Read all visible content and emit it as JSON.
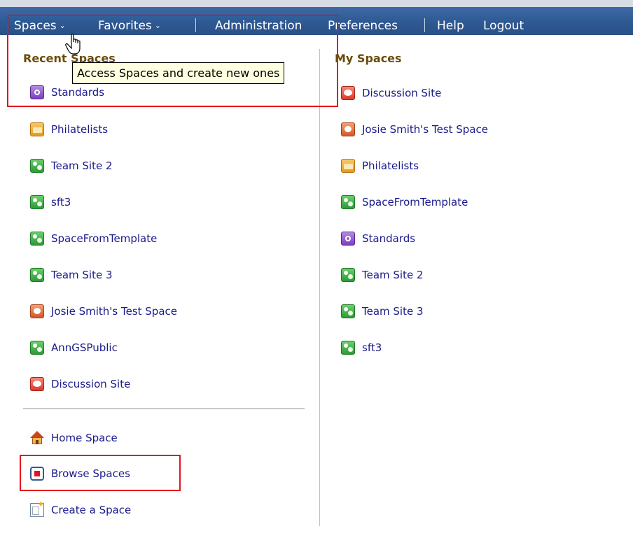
{
  "menu": {
    "spaces_label": "Spaces",
    "favorites_label": "Favorites",
    "administration_label": "Administration",
    "preferences_label": "Preferences",
    "help_label": "Help",
    "logout_label": "Logout",
    "chevron": "⌄"
  },
  "tooltip": "Access Spaces and create new ones",
  "recent": {
    "title": "Recent Spaces",
    "items": [
      {
        "label": "Standards",
        "icon": "purple-space-icon"
      },
      {
        "label": "Philatelists",
        "icon": "orange-folder-space-icon"
      },
      {
        "label": "Team Site 2",
        "icon": "green-team-space-icon"
      },
      {
        "label": "sft3",
        "icon": "green-team-space-icon"
      },
      {
        "label": "SpaceFromTemplate",
        "icon": "green-team-space-icon"
      },
      {
        "label": "Team Site 3",
        "icon": "green-team-space-icon"
      },
      {
        "label": "Josie Smith's Test Space",
        "icon": "orange-person-space-icon"
      },
      {
        "label": "AnnGSPublic",
        "icon": "green-team-space-icon"
      },
      {
        "label": "Discussion Site",
        "icon": "red-discussion-space-icon"
      }
    ]
  },
  "actions": {
    "home_space": "Home Space",
    "browse_spaces": "Browse Spaces",
    "create_space": "Create a Space"
  },
  "myspaces": {
    "title": "My Spaces",
    "items": [
      {
        "label": "Discussion Site",
        "icon": "red-discussion-space-icon"
      },
      {
        "label": "Josie Smith's Test Space",
        "icon": "orange-person-space-icon"
      },
      {
        "label": "Philatelists",
        "icon": "orange-folder-space-icon"
      },
      {
        "label": "SpaceFromTemplate",
        "icon": "green-team-space-icon"
      },
      {
        "label": "Standards",
        "icon": "purple-space-icon"
      },
      {
        "label": "Team Site 2",
        "icon": "green-team-space-icon"
      },
      {
        "label": "Team Site 3",
        "icon": "green-team-space-icon"
      },
      {
        "label": "sft3",
        "icon": "green-team-space-icon"
      }
    ]
  },
  "colors": {
    "menubar": "#2f5a94",
    "highlight_box": "#e3131b",
    "section_title": "#6b4c06",
    "link": "#1a1a8c"
  }
}
